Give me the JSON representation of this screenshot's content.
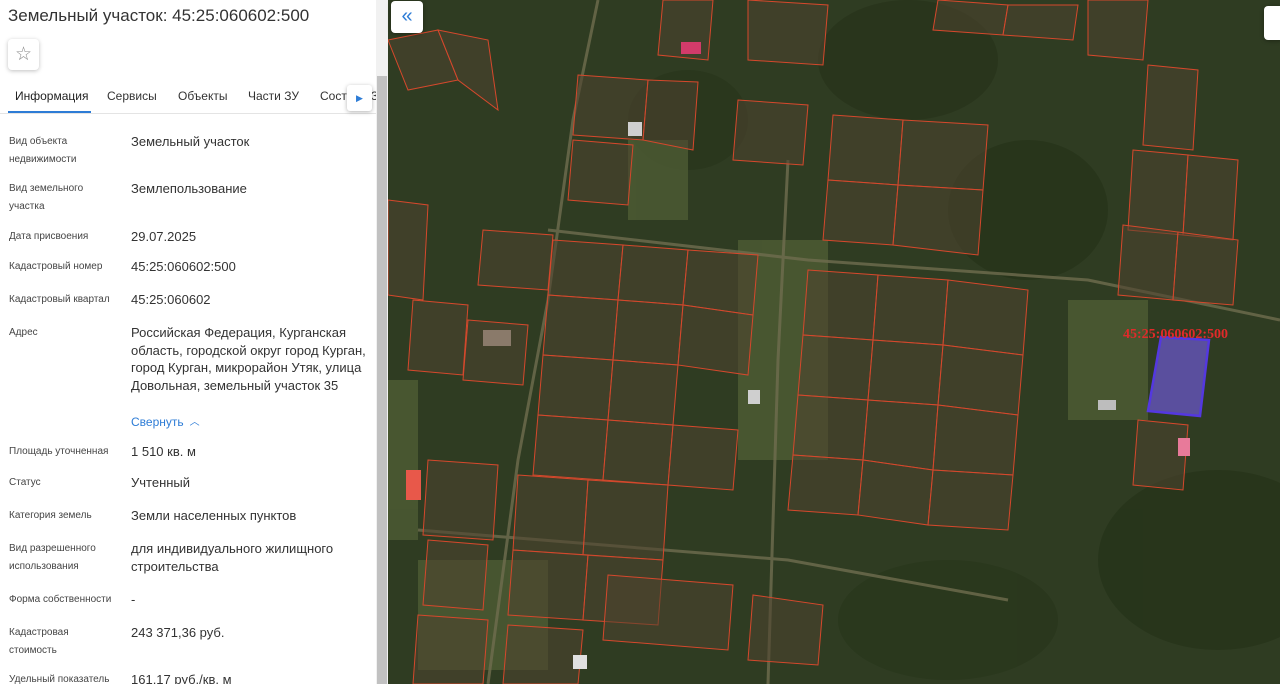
{
  "panel": {
    "title": "Земельный участок: 45:25:060602:500",
    "favorite_icon": "star-outline-icon"
  },
  "tabs": [
    {
      "label": "Информация",
      "active": true
    },
    {
      "label": "Сервисы",
      "active": false
    },
    {
      "label": "Объекты",
      "active": false
    },
    {
      "label": "Части ЗУ",
      "active": false
    },
    {
      "label": "Состав ЕЗ",
      "active": false
    }
  ],
  "properties": [
    {
      "label": "Вид объекта недвижимости",
      "value": "Земельный участок"
    },
    {
      "label": "Вид земельного участка",
      "value": "Землепользование"
    },
    {
      "label": "Дата присвоения",
      "value": "29.07.2025"
    },
    {
      "label": "Кадастровый номер",
      "value": "45:25:060602:500"
    },
    {
      "label": "Кадастровый квартал",
      "value": "45:25:060602"
    },
    {
      "label": "Адрес",
      "value": "Российская Федерация, Курганская область, городской округ город Курган, город Курган, микрорайон Утяк, улица Довольная, земельный участок 35"
    },
    {
      "label": "Площадь уточненная",
      "value": "1 510 кв. м"
    },
    {
      "label": "Статус",
      "value": "Учтенный"
    },
    {
      "label": "Категория земель",
      "value": "Земли населенных пунктов"
    },
    {
      "label": "Вид разрешенного использования",
      "value": "для индивидуального жилищного строительства"
    },
    {
      "label": "Форма собственности",
      "value": "-"
    },
    {
      "label": "Кадастровая стоимость",
      "value": "243 371,36 руб."
    },
    {
      "label": "Удельный показатель",
      "value": "161,17 руб./кв. м"
    }
  ],
  "collapse_link": "Свернуть",
  "map": {
    "parcel_label": "45:25:060602:500",
    "collapse_icon": "double-chevron-left-icon",
    "colors": {
      "forest": "#2f3c22",
      "clearing": "#5a5a3a",
      "parcel_border": "#d5482c",
      "selected_fill": "#6a55c8",
      "selected_border": "#5438e0",
      "label": "#e02a2a",
      "accent": "#2d7cd6"
    }
  }
}
